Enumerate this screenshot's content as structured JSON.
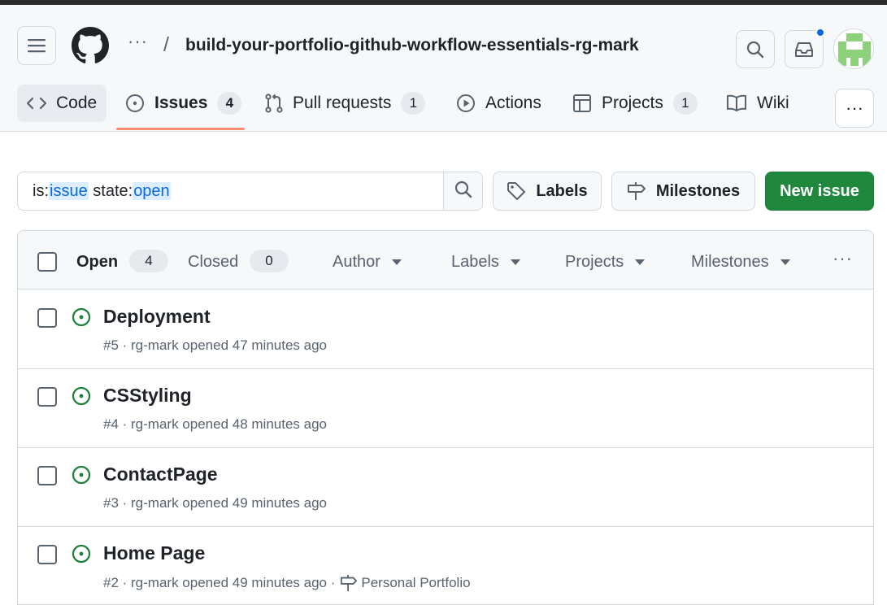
{
  "header": {
    "breadcrumb_more": "···",
    "breadcrumb_separator": "/",
    "repo_name": "build-your-portfolio-github-workflow-essentials-rg-mark"
  },
  "tabs": [
    {
      "label": "Code",
      "icon": "code-icon"
    },
    {
      "label": "Issues",
      "count": "4",
      "icon": "issue-opened-icon",
      "selected": true
    },
    {
      "label": "Pull requests",
      "count": "1",
      "icon": "git-pull-request-icon"
    },
    {
      "label": "Actions",
      "icon": "play-icon"
    },
    {
      "label": "Projects",
      "count": "1",
      "icon": "table-icon"
    },
    {
      "label": "Wiki",
      "icon": "book-icon"
    }
  ],
  "tabs_more": "···",
  "search": {
    "qualifier1_key": "is:",
    "qualifier1_value": "issue",
    "qualifier2_key": " state:",
    "qualifier2_value": "open"
  },
  "buttons": {
    "labels": "Labels",
    "milestones": "Milestones",
    "new_issue": "New issue"
  },
  "list_header": {
    "open_label": "Open",
    "open_count": "4",
    "closed_label": "Closed",
    "closed_count": "0",
    "filters": [
      "Author",
      "Labels",
      "Projects",
      "Milestones"
    ],
    "more": "···"
  },
  "issues": [
    {
      "title": "Deployment",
      "meta": "#5 · rg-mark opened 47 minutes ago"
    },
    {
      "title": "CSStyling",
      "meta": "#4 · rg-mark opened 48 minutes ago"
    },
    {
      "title": "ContactPage",
      "meta": "#3 · rg-mark opened 49 minutes ago"
    },
    {
      "title": "Home Page",
      "meta": "#2 · rg-mark opened 49 minutes ago ·",
      "milestone": "Personal Portfolio"
    }
  ],
  "colors": {
    "accent_green": "#1f883d",
    "open_icon": "#1a7f37",
    "selected_tab_underline": "#fd8c73",
    "search_highlight": "#0969da",
    "notification_dot": "#0969da"
  }
}
